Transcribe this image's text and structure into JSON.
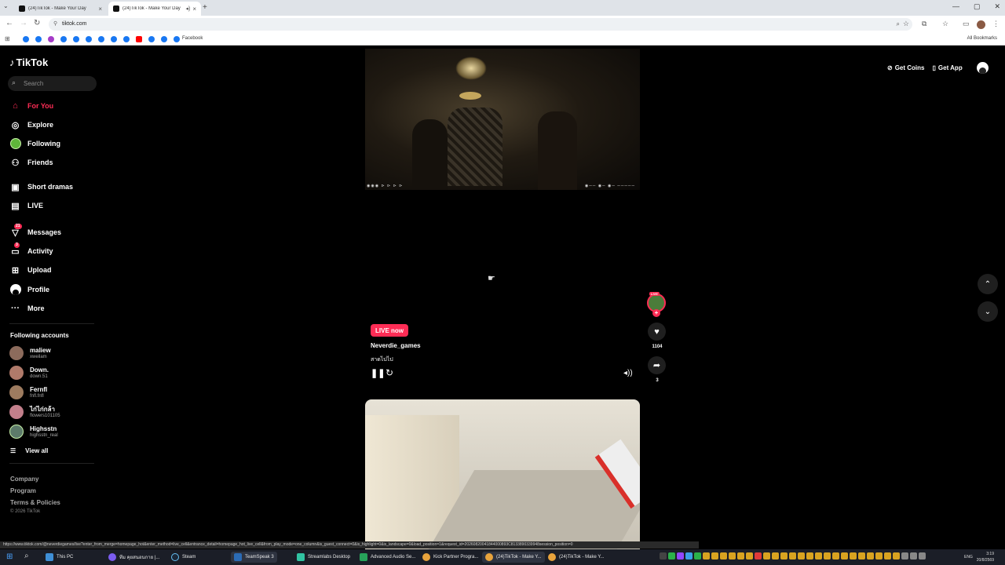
{
  "browser": {
    "tabs": [
      {
        "title": "(24)TikTok - Make Your Day",
        "active": false
      },
      {
        "title": "(24)TikTok - Make Your Day",
        "active": true
      }
    ],
    "url": "tiktok.com",
    "bookmarks": {
      "facebook_label": "Facebook",
      "all_bookmarks_label": "All Bookmarks"
    },
    "status_url": "https://www.tiktok.com/@neverdiegames/live?enter_from_merge=homepage_hot&enter_method=live_cell&entrance_detail=homepage_hot_live_cell&from_play_mode=one_column&is_guest_connect=0&is_highlight=0&is_landscape=0&load_position=1&request_id=20260820041844000893C8133890339948session_position=0"
  },
  "tiktok": {
    "logo": "TikTok",
    "search_placeholder": "Search",
    "nav": [
      {
        "label": "For You",
        "icon": "home-icon",
        "active": true
      },
      {
        "label": "Explore",
        "icon": "compass-icon"
      },
      {
        "label": "Following",
        "icon": "following-icon"
      },
      {
        "label": "Friends",
        "icon": "friends-icon"
      },
      {
        "label": "Short dramas",
        "icon": "short-dramas-icon"
      },
      {
        "label": "LIVE",
        "icon": "live-icon"
      },
      {
        "label": "Messages",
        "icon": "messages-icon",
        "badge": "21"
      },
      {
        "label": "Activity",
        "icon": "activity-icon",
        "badge": "3"
      },
      {
        "label": "Upload",
        "icon": "upload-icon"
      },
      {
        "label": "Profile",
        "icon": "profile-icon"
      },
      {
        "label": "More",
        "icon": "more-icon"
      }
    ],
    "following_title": "Following accounts",
    "accounts": [
      {
        "name": "maliew",
        "handle": "xweilam"
      },
      {
        "name": "Down.",
        "handle": "down.51"
      },
      {
        "name": "Fernfl",
        "handle": "fnfl.fnfl"
      },
      {
        "name": "ไก่ไก่กล้า",
        "handle": "flowers101105"
      },
      {
        "name": "Highsstn",
        "handle": "highsstn_real"
      }
    ],
    "view_all": "View all",
    "footer": {
      "company": "Company",
      "program": "Program",
      "terms": "Terms & Policies",
      "copyright": "© 2026 TikTok"
    },
    "header": {
      "get_coins": "Get Coins",
      "get_app": "Get App"
    },
    "live_post": {
      "badge": "LIVE now",
      "streamer": "Neverdie_games",
      "caption": "สาดไปไป",
      "creator_badge": "LIVE",
      "likes": "1104",
      "shares": "3"
    }
  },
  "taskbar": {
    "items": [
      {
        "label": "This PC"
      },
      {
        "label": "ทีม คุยสนอนกาย |..."
      },
      {
        "label": "Steam"
      },
      {
        "label": "TeamSpeak 3"
      },
      {
        "label": "Streamlabs Desktop"
      },
      {
        "label": "Advanced Audio Se..."
      },
      {
        "label": "Kick Partner Progra..."
      },
      {
        "label": "(24)TikTok - Make Y..."
      },
      {
        "label": "(24)TikTok - Make Y..."
      }
    ],
    "lang": "ENG",
    "time": "3:19",
    "date": "20/8/2569"
  },
  "colors": {
    "accent": "#fe2c55",
    "page_bg": "#000000"
  }
}
